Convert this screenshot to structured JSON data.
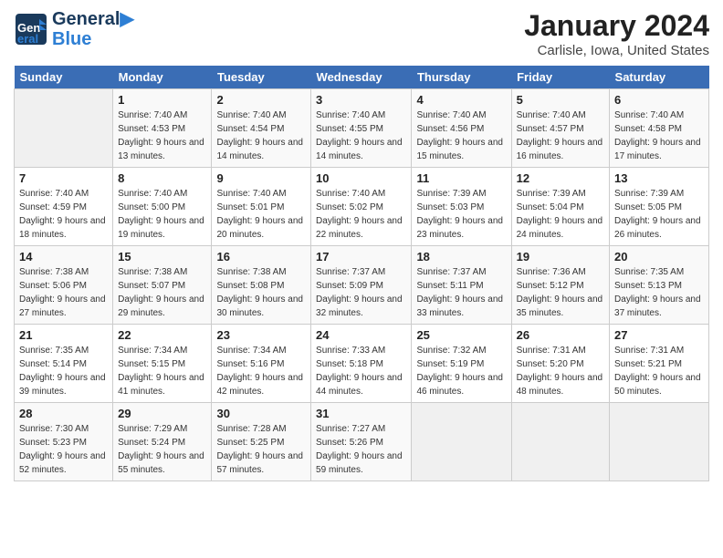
{
  "header": {
    "logo_line1": "General",
    "logo_line2": "Blue",
    "month": "January 2024",
    "location": "Carlisle, Iowa, United States"
  },
  "days_of_week": [
    "Sunday",
    "Monday",
    "Tuesday",
    "Wednesday",
    "Thursday",
    "Friday",
    "Saturday"
  ],
  "weeks": [
    [
      {
        "day": "",
        "sunrise": "",
        "sunset": "",
        "daylight": ""
      },
      {
        "day": "1",
        "sunrise": "Sunrise: 7:40 AM",
        "sunset": "Sunset: 4:53 PM",
        "daylight": "Daylight: 9 hours and 13 minutes."
      },
      {
        "day": "2",
        "sunrise": "Sunrise: 7:40 AM",
        "sunset": "Sunset: 4:54 PM",
        "daylight": "Daylight: 9 hours and 14 minutes."
      },
      {
        "day": "3",
        "sunrise": "Sunrise: 7:40 AM",
        "sunset": "Sunset: 4:55 PM",
        "daylight": "Daylight: 9 hours and 14 minutes."
      },
      {
        "day": "4",
        "sunrise": "Sunrise: 7:40 AM",
        "sunset": "Sunset: 4:56 PM",
        "daylight": "Daylight: 9 hours and 15 minutes."
      },
      {
        "day": "5",
        "sunrise": "Sunrise: 7:40 AM",
        "sunset": "Sunset: 4:57 PM",
        "daylight": "Daylight: 9 hours and 16 minutes."
      },
      {
        "day": "6",
        "sunrise": "Sunrise: 7:40 AM",
        "sunset": "Sunset: 4:58 PM",
        "daylight": "Daylight: 9 hours and 17 minutes."
      }
    ],
    [
      {
        "day": "7",
        "sunrise": "Sunrise: 7:40 AM",
        "sunset": "Sunset: 4:59 PM",
        "daylight": "Daylight: 9 hours and 18 minutes."
      },
      {
        "day": "8",
        "sunrise": "Sunrise: 7:40 AM",
        "sunset": "Sunset: 5:00 PM",
        "daylight": "Daylight: 9 hours and 19 minutes."
      },
      {
        "day": "9",
        "sunrise": "Sunrise: 7:40 AM",
        "sunset": "Sunset: 5:01 PM",
        "daylight": "Daylight: 9 hours and 20 minutes."
      },
      {
        "day": "10",
        "sunrise": "Sunrise: 7:40 AM",
        "sunset": "Sunset: 5:02 PM",
        "daylight": "Daylight: 9 hours and 22 minutes."
      },
      {
        "day": "11",
        "sunrise": "Sunrise: 7:39 AM",
        "sunset": "Sunset: 5:03 PM",
        "daylight": "Daylight: 9 hours and 23 minutes."
      },
      {
        "day": "12",
        "sunrise": "Sunrise: 7:39 AM",
        "sunset": "Sunset: 5:04 PM",
        "daylight": "Daylight: 9 hours and 24 minutes."
      },
      {
        "day": "13",
        "sunrise": "Sunrise: 7:39 AM",
        "sunset": "Sunset: 5:05 PM",
        "daylight": "Daylight: 9 hours and 26 minutes."
      }
    ],
    [
      {
        "day": "14",
        "sunrise": "Sunrise: 7:38 AM",
        "sunset": "Sunset: 5:06 PM",
        "daylight": "Daylight: 9 hours and 27 minutes."
      },
      {
        "day": "15",
        "sunrise": "Sunrise: 7:38 AM",
        "sunset": "Sunset: 5:07 PM",
        "daylight": "Daylight: 9 hours and 29 minutes."
      },
      {
        "day": "16",
        "sunrise": "Sunrise: 7:38 AM",
        "sunset": "Sunset: 5:08 PM",
        "daylight": "Daylight: 9 hours and 30 minutes."
      },
      {
        "day": "17",
        "sunrise": "Sunrise: 7:37 AM",
        "sunset": "Sunset: 5:09 PM",
        "daylight": "Daylight: 9 hours and 32 minutes."
      },
      {
        "day": "18",
        "sunrise": "Sunrise: 7:37 AM",
        "sunset": "Sunset: 5:11 PM",
        "daylight": "Daylight: 9 hours and 33 minutes."
      },
      {
        "day": "19",
        "sunrise": "Sunrise: 7:36 AM",
        "sunset": "Sunset: 5:12 PM",
        "daylight": "Daylight: 9 hours and 35 minutes."
      },
      {
        "day": "20",
        "sunrise": "Sunrise: 7:35 AM",
        "sunset": "Sunset: 5:13 PM",
        "daylight": "Daylight: 9 hours and 37 minutes."
      }
    ],
    [
      {
        "day": "21",
        "sunrise": "Sunrise: 7:35 AM",
        "sunset": "Sunset: 5:14 PM",
        "daylight": "Daylight: 9 hours and 39 minutes."
      },
      {
        "day": "22",
        "sunrise": "Sunrise: 7:34 AM",
        "sunset": "Sunset: 5:15 PM",
        "daylight": "Daylight: 9 hours and 41 minutes."
      },
      {
        "day": "23",
        "sunrise": "Sunrise: 7:34 AM",
        "sunset": "Sunset: 5:16 PM",
        "daylight": "Daylight: 9 hours and 42 minutes."
      },
      {
        "day": "24",
        "sunrise": "Sunrise: 7:33 AM",
        "sunset": "Sunset: 5:18 PM",
        "daylight": "Daylight: 9 hours and 44 minutes."
      },
      {
        "day": "25",
        "sunrise": "Sunrise: 7:32 AM",
        "sunset": "Sunset: 5:19 PM",
        "daylight": "Daylight: 9 hours and 46 minutes."
      },
      {
        "day": "26",
        "sunrise": "Sunrise: 7:31 AM",
        "sunset": "Sunset: 5:20 PM",
        "daylight": "Daylight: 9 hours and 48 minutes."
      },
      {
        "day": "27",
        "sunrise": "Sunrise: 7:31 AM",
        "sunset": "Sunset: 5:21 PM",
        "daylight": "Daylight: 9 hours and 50 minutes."
      }
    ],
    [
      {
        "day": "28",
        "sunrise": "Sunrise: 7:30 AM",
        "sunset": "Sunset: 5:23 PM",
        "daylight": "Daylight: 9 hours and 52 minutes."
      },
      {
        "day": "29",
        "sunrise": "Sunrise: 7:29 AM",
        "sunset": "Sunset: 5:24 PM",
        "daylight": "Daylight: 9 hours and 55 minutes."
      },
      {
        "day": "30",
        "sunrise": "Sunrise: 7:28 AM",
        "sunset": "Sunset: 5:25 PM",
        "daylight": "Daylight: 9 hours and 57 minutes."
      },
      {
        "day": "31",
        "sunrise": "Sunrise: 7:27 AM",
        "sunset": "Sunset: 5:26 PM",
        "daylight": "Daylight: 9 hours and 59 minutes."
      },
      {
        "day": "",
        "sunrise": "",
        "sunset": "",
        "daylight": ""
      },
      {
        "day": "",
        "sunrise": "",
        "sunset": "",
        "daylight": ""
      },
      {
        "day": "",
        "sunrise": "",
        "sunset": "",
        "daylight": ""
      }
    ]
  ]
}
